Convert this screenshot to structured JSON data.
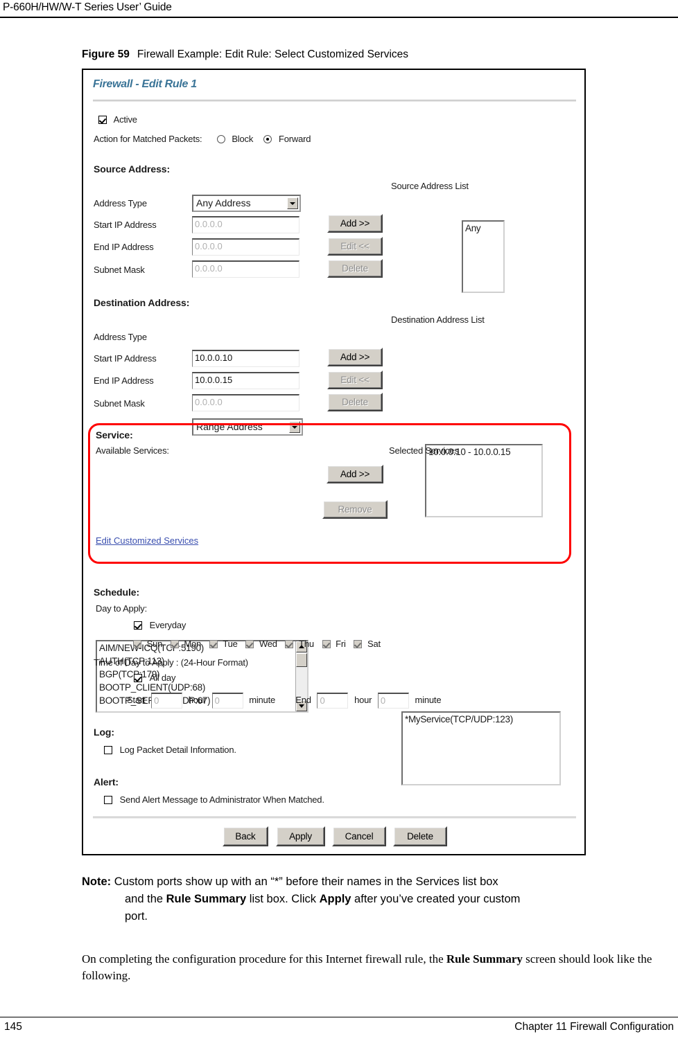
{
  "page": {
    "header_text": "P-660H/HW/W-T Series User’ Guide",
    "footer_page_number": "145",
    "footer_chapter": "Chapter 11 Firewall Configuration"
  },
  "figure": {
    "number": "Figure 59",
    "title": "Firewall Example: Edit Rule: Select Customized Services"
  },
  "screen": {
    "title": "Firewall - Edit Rule 1",
    "active": {
      "label": "Active",
      "checked": true
    },
    "action": {
      "label": "Action for Matched Packets:",
      "options": [
        {
          "label": "Block",
          "selected": false
        },
        {
          "label": "Forward",
          "selected": true
        }
      ]
    },
    "source_address": {
      "heading": "Source Address:",
      "list_label": "Source Address List",
      "fields": [
        {
          "label": "Address Type",
          "type": "select",
          "value": "Any Address"
        },
        {
          "label": "Start IP Address",
          "type": "text",
          "value": "0.0.0.0",
          "ghost": true
        },
        {
          "label": "End IP Address",
          "type": "text",
          "value": "0.0.0.0",
          "ghost": true
        },
        {
          "label": "Subnet Mask",
          "type": "text",
          "value": "0.0.0.0",
          "ghost": true
        }
      ],
      "buttons": [
        {
          "label": "Add >>",
          "disabled": false
        },
        {
          "label": "Edit <<",
          "disabled": true
        },
        {
          "label": "Delete",
          "disabled": true
        }
      ],
      "list_items": [
        "Any"
      ]
    },
    "destination_address": {
      "heading": "Destination Address:",
      "list_label": "Destination Address List",
      "fields": [
        {
          "label": "Address Type",
          "type": "select",
          "value": "Range Address"
        },
        {
          "label": "Start IP Address",
          "type": "text",
          "value": "10.0.0.10",
          "ghost": false
        },
        {
          "label": "End IP Address",
          "type": "text",
          "value": "10.0.0.15",
          "ghost": false
        },
        {
          "label": "Subnet Mask",
          "type": "text",
          "value": "0.0.0.0",
          "ghost": true
        }
      ],
      "buttons": [
        {
          "label": "Add >>",
          "disabled": false
        },
        {
          "label": "Edit <<",
          "disabled": true
        },
        {
          "label": "Delete",
          "disabled": true
        }
      ],
      "list_items": [
        "10.0.0.10 - 10.0.0.15"
      ]
    },
    "service": {
      "heading": "Service:",
      "available_label": "Available Services:",
      "selected_label": "Selected Services",
      "available_items": [
        "AIM/NEW-ICQ(TCP:5190)",
        "AUTH(TCP:113)",
        "BGP(TCP:179)",
        "BOOTP_CLIENT(UDP:68)",
        "BOOTP_SERVER(UDP:67)"
      ],
      "selected_items": [
        "*MyService(TCP/UDP:123)"
      ],
      "add_button": "Add >>",
      "remove_button": "Remove",
      "edit_link": "Edit Customized Services",
      "highlight_color": "#fe0000"
    },
    "schedule": {
      "heading": "Schedule:",
      "day_to_apply_label": "Day to Apply:",
      "everyday": {
        "label": "Everyday",
        "checked": true
      },
      "days": [
        {
          "label": "Sun",
          "checked": true,
          "disabled": true
        },
        {
          "label": "Mon",
          "checked": true,
          "disabled": true
        },
        {
          "label": "Tue",
          "checked": true,
          "disabled": true
        },
        {
          "label": "Wed",
          "checked": true,
          "disabled": true
        },
        {
          "label": "Thu",
          "checked": true,
          "disabled": true
        },
        {
          "label": "Fri",
          "checked": true,
          "disabled": true
        },
        {
          "label": "Sat",
          "checked": true,
          "disabled": true
        }
      ],
      "time_label": "Time of Day to Apply : (24-Hour Format)",
      "all_day": {
        "label": "All day",
        "checked": true
      },
      "start_label": "Start",
      "end_label": "End",
      "hour_label": "hour",
      "minute_label": "minute",
      "start_hour": "0",
      "start_minute": "0",
      "end_hour": "0",
      "end_minute": "0"
    },
    "log": {
      "heading": "Log:",
      "checkbox_label": "Log Packet Detail Information.",
      "checked": false
    },
    "alert": {
      "heading": "Alert:",
      "checkbox_label": "Send Alert Message to Administrator When Matched.",
      "checked": false
    },
    "footer_buttons": [
      {
        "label": "Back"
      },
      {
        "label": "Apply"
      },
      {
        "label": "Cancel"
      },
      {
        "label": "Delete"
      }
    ]
  },
  "note": {
    "lead": "Note:",
    "line1": "Custom ports show up with an “*” before their names in the Services list box",
    "line2_a": "and the ",
    "line2_b": "Rule Summary",
    "line2_c": " list box. Click ",
    "line2_d": "Apply",
    "line2_e": " after you’ve created your custom",
    "line3": "port."
  },
  "paragraph": {
    "text_a": "On completing the configuration procedure for this Internet firewall rule, the ",
    "text_b": "Rule Summary",
    "text_c": " screen should look like the following."
  }
}
